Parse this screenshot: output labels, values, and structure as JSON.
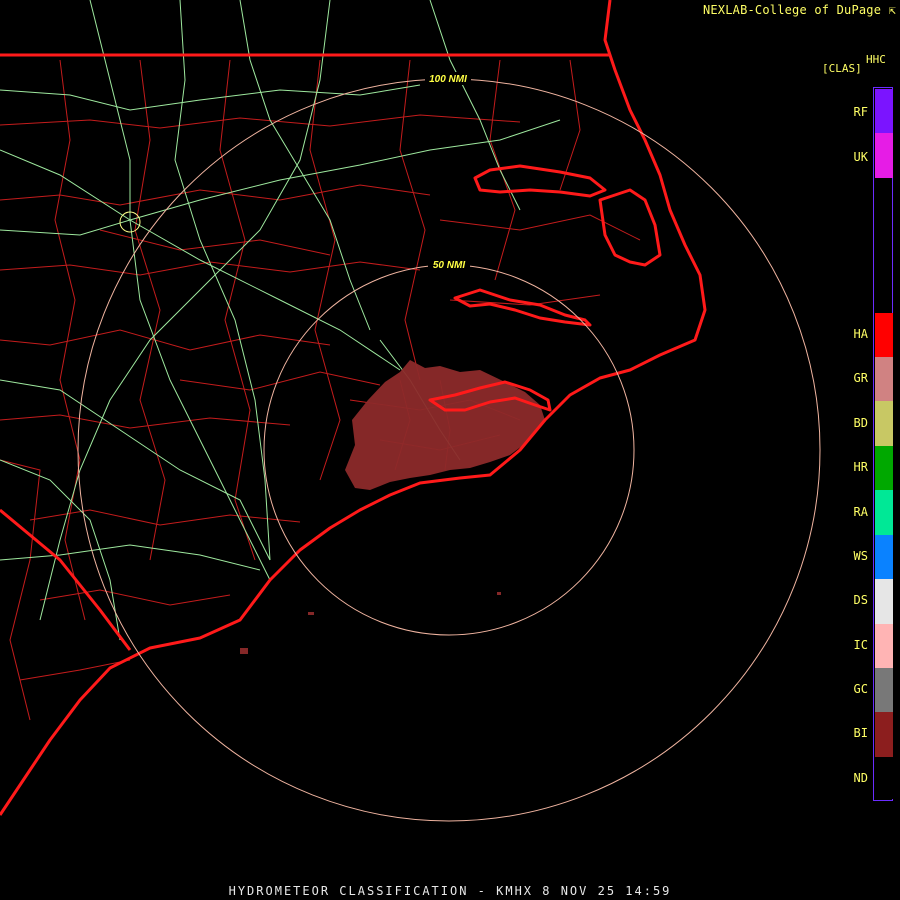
{
  "header": {
    "credit": "NEXLAB-College of DuPage ⇱"
  },
  "footer": {
    "title": "HYDROMETEOR CLASSIFICATION - KMHX 8 NOV 25 14:59"
  },
  "range_rings": [
    {
      "label": "100 NMI"
    },
    {
      "label": "50 NMI"
    }
  ],
  "legend": {
    "product": "HHC",
    "units": "[CLAS]",
    "items": [
      {
        "label": "RF",
        "color": "#7b14ff"
      },
      {
        "label": "UK",
        "color": "#e61ce6"
      },
      {
        "label": "HA",
        "color": "#ff0000"
      },
      {
        "label": "GR",
        "color": "#d08282"
      },
      {
        "label": "BD",
        "color": "#c8c864"
      },
      {
        "label": "HR",
        "color": "#00a800"
      },
      {
        "label": "RA",
        "color": "#00e896"
      },
      {
        "label": "WS",
        "color": "#0a82ff"
      },
      {
        "label": "DS",
        "color": "#e6e6e6"
      },
      {
        "label": "IC",
        "color": "#ffb4b4"
      },
      {
        "label": "GC",
        "color": "#787878"
      },
      {
        "label": "BI",
        "color": "#8c1e1e"
      },
      {
        "label": "ND",
        "color": "#000000"
      }
    ]
  },
  "colors": {
    "state_border": "#ff1a1a",
    "county_line": "#c41c1c",
    "highway": "#9ee89e",
    "range_ring": "#f0b4a0",
    "echo": "#8c2a2a"
  }
}
